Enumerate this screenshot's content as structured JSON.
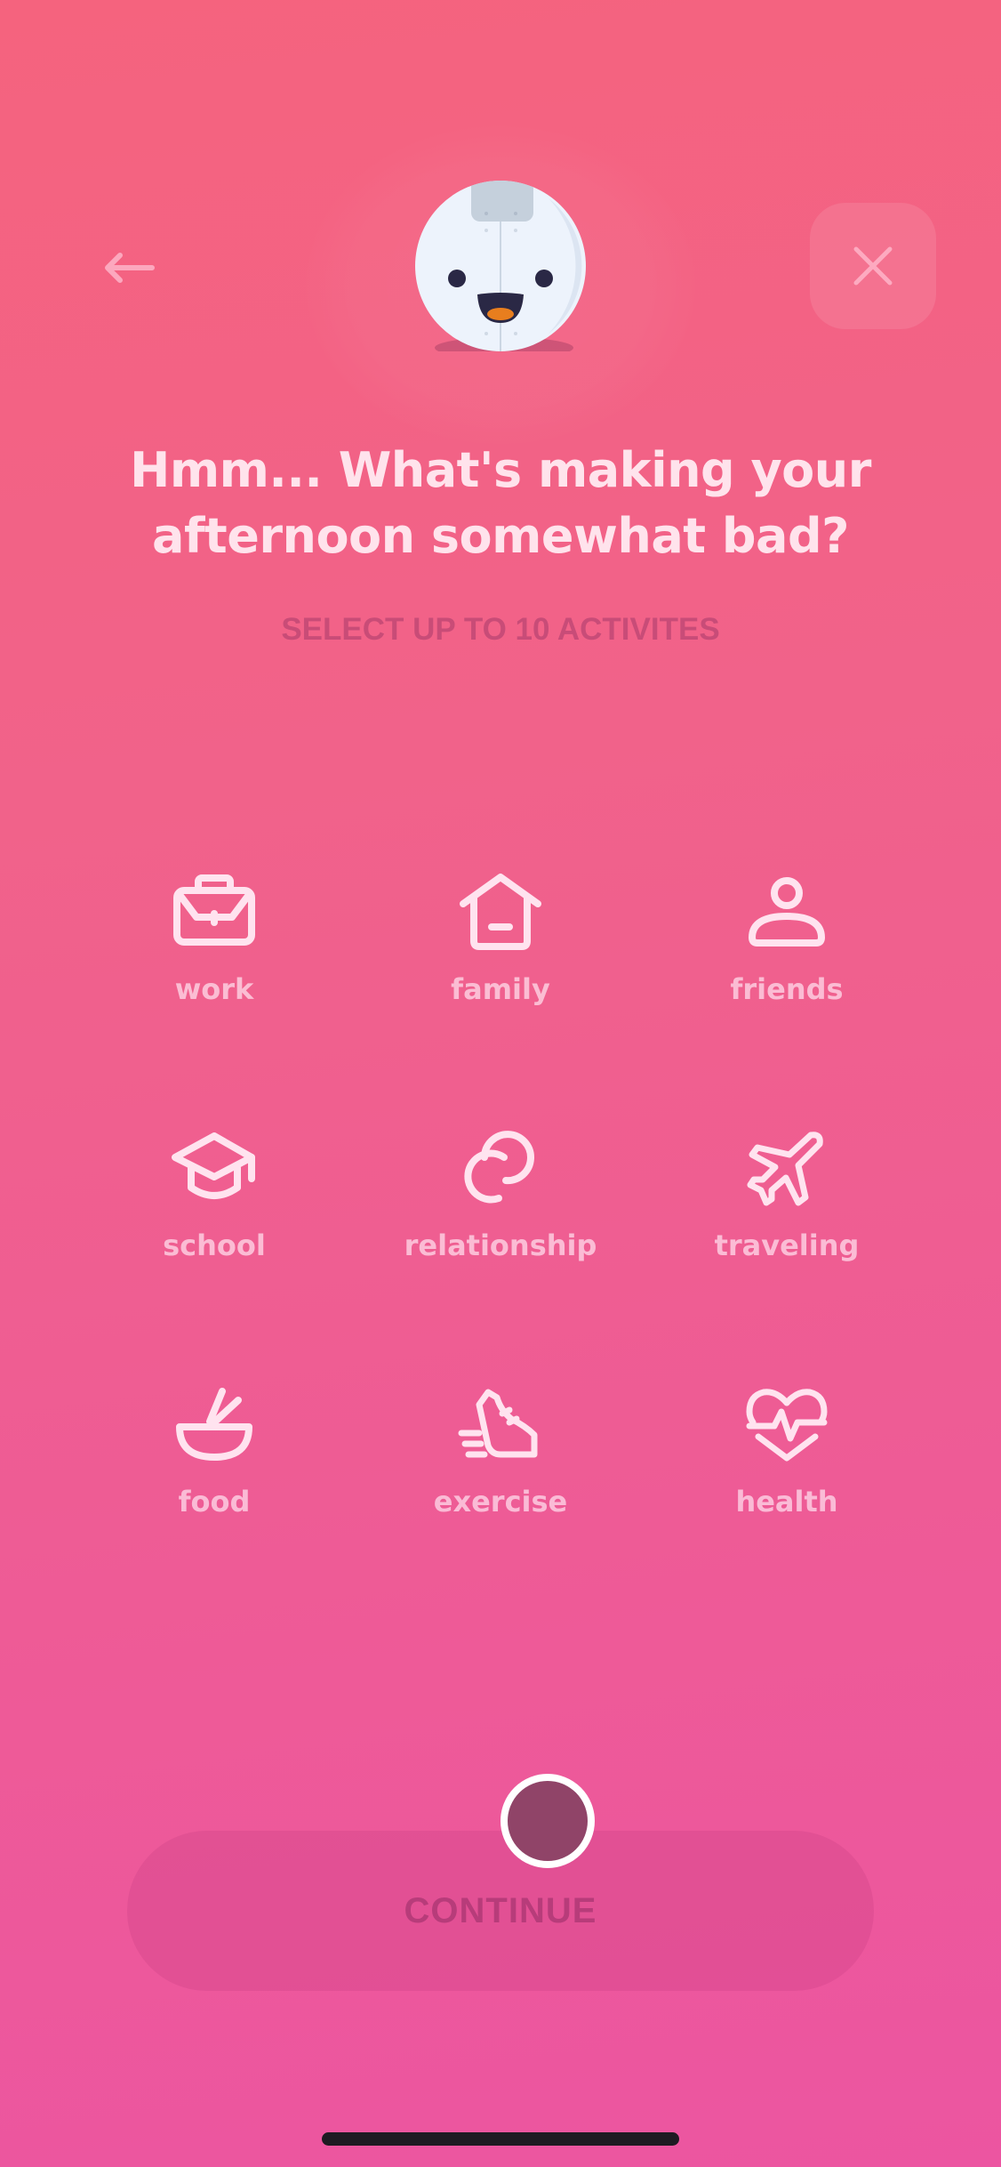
{
  "header": {
    "back_icon": "arrow-left-icon",
    "close_icon": "close-x-icon",
    "mascot": "smiling-robot-mascot"
  },
  "prompt": {
    "title_line1": "Hmm... What's making your",
    "title_line2": "afternoon somewhat bad?",
    "subtitle": "SELECT UP TO 10 ACTIVITES"
  },
  "activities": [
    {
      "label": "work",
      "icon": "briefcase-icon"
    },
    {
      "label": "family",
      "icon": "house-icon"
    },
    {
      "label": "friends",
      "icon": "person-icon"
    },
    {
      "label": "school",
      "icon": "graduation-cap-icon"
    },
    {
      "label": "relationship",
      "icon": "interlocked-rings-icon"
    },
    {
      "label": "traveling",
      "icon": "airplane-icon"
    },
    {
      "label": "food",
      "icon": "bowl-chopsticks-icon"
    },
    {
      "label": "exercise",
      "icon": "running-shoe-icon"
    },
    {
      "label": "health",
      "icon": "heart-pulse-icon"
    }
  ],
  "footer": {
    "continue_label": "CONTINUE"
  },
  "colors": {
    "bg_top": "#F5637E",
    "bg_bottom": "#EC55A1",
    "title_text": "#FFE3EC",
    "icon_stroke": "#FFE3EF",
    "mascot_body": "#EDF3FC",
    "mascot_eyes": "#2A2845",
    "mascot_tongue": "#E87E1E"
  }
}
